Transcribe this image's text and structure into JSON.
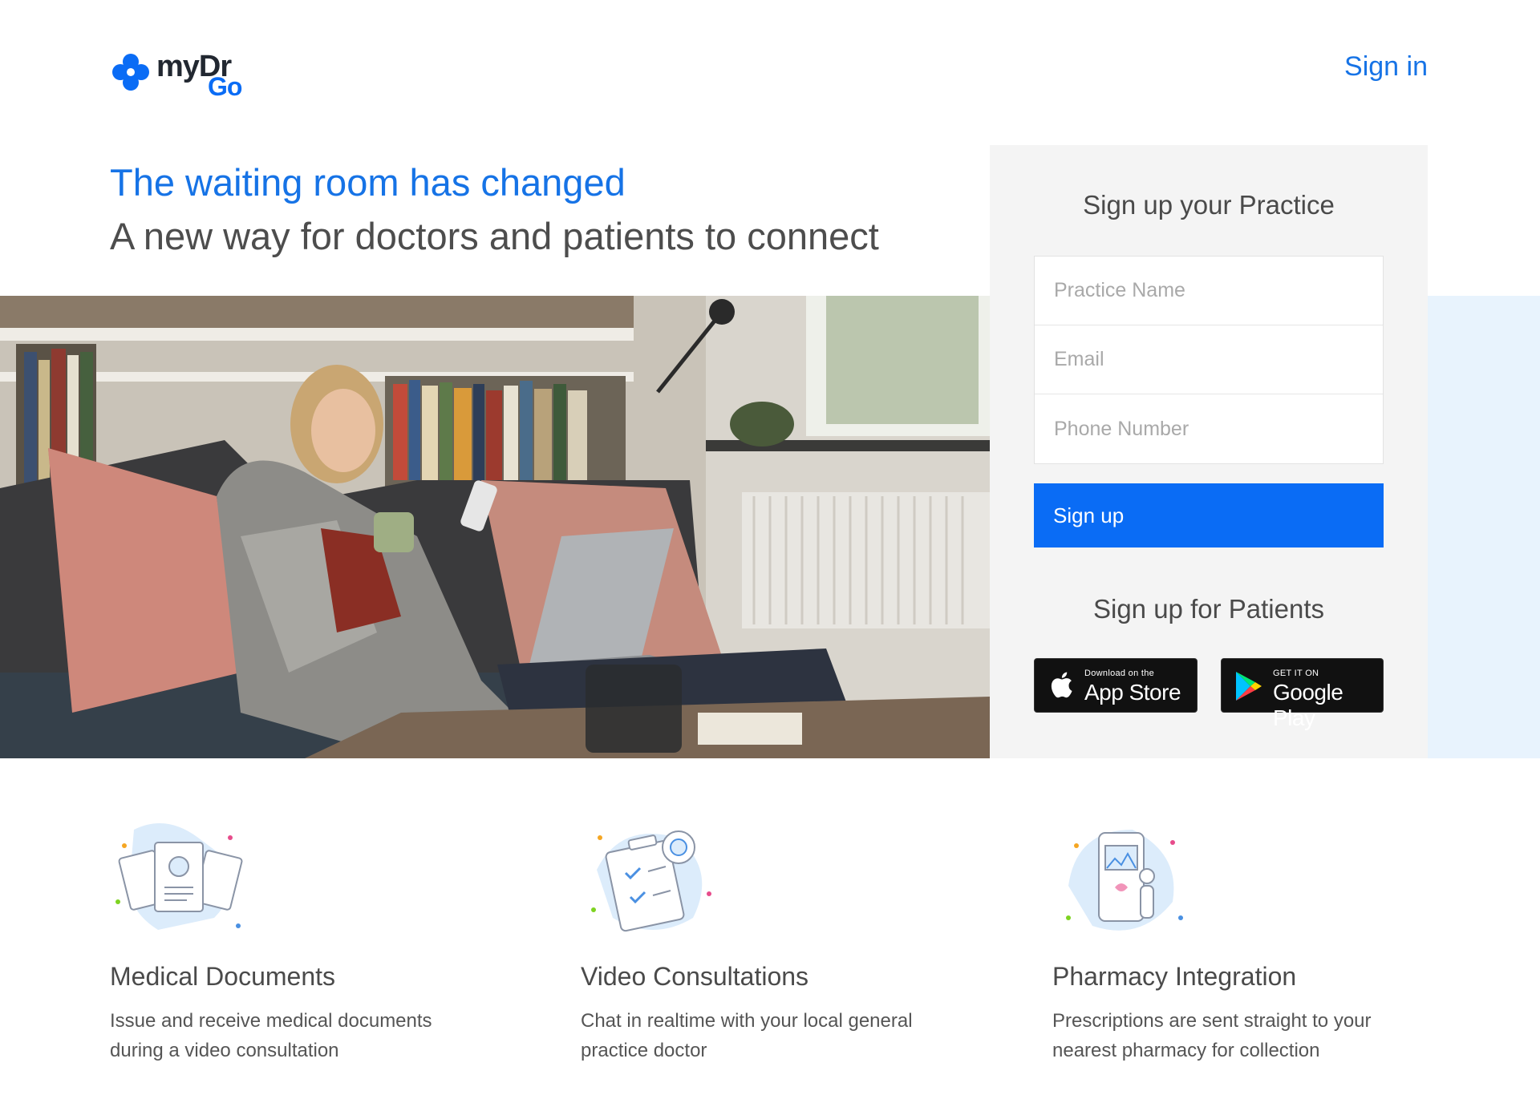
{
  "brand": {
    "name_top": "myDr",
    "name_bottom": "Go",
    "color": "#0a6cf5"
  },
  "header": {
    "signin_label": "Sign in"
  },
  "hero": {
    "title": "The waiting room has changed",
    "subtitle": "A new way for doctors and patients to connect"
  },
  "practice_signup": {
    "title": "Sign up your Practice",
    "fields": {
      "practice_name": {
        "placeholder": "Practice Name",
        "value": ""
      },
      "email": {
        "placeholder": "Email",
        "value": ""
      },
      "phone": {
        "placeholder": "Phone Number",
        "value": ""
      }
    },
    "button_label": "Sign up"
  },
  "patient_signup": {
    "title": "Sign up for Patients",
    "app_store": {
      "small": "Download on the",
      "big": "App Store",
      "icon": "apple-icon"
    },
    "google_play": {
      "small": "GET IT ON",
      "big": "Google Play",
      "icon": "google-play-icon"
    }
  },
  "features": [
    {
      "icon": "medical-documents-icon",
      "title": "Medical Documents",
      "description": "Issue and receive medical documents during a video consultation"
    },
    {
      "icon": "video-consultations-icon",
      "title": "Video Consultations",
      "description": "Chat in realtime with your local general practice doctor"
    },
    {
      "icon": "pharmacy-integration-icon",
      "title": "Pharmacy Integration",
      "description": "Prescriptions are sent straight to your nearest pharmacy for collection"
    }
  ],
  "colors": {
    "accent": "#1673e6",
    "button": "#0a6cf5",
    "panel": "#f4f4f4",
    "band": "#e8f3fd"
  }
}
